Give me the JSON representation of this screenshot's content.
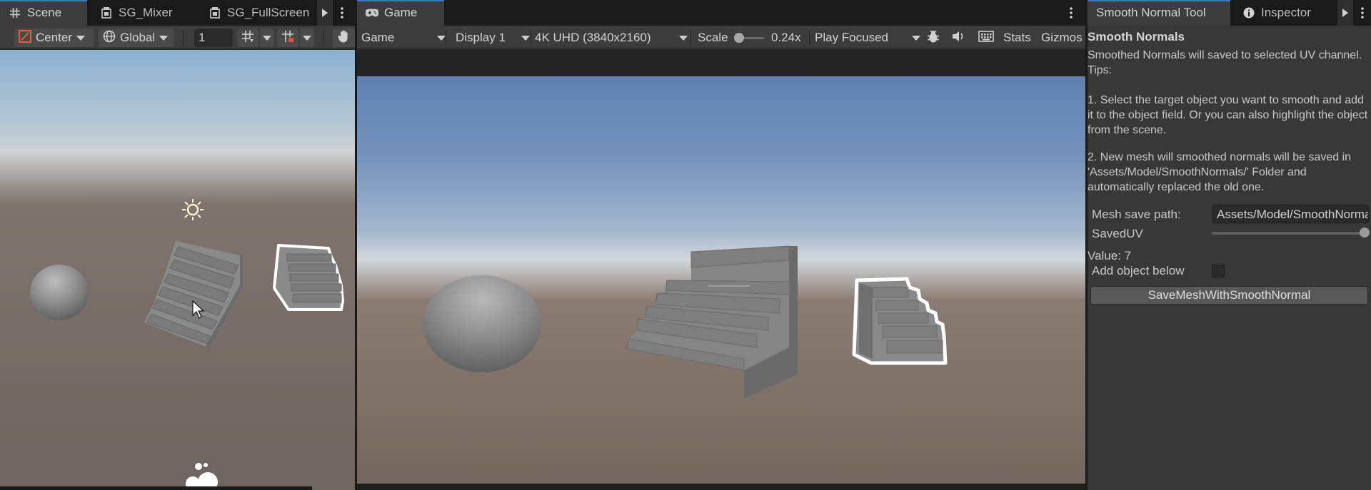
{
  "scene_panel": {
    "tabs": [
      {
        "label": "Scene",
        "icon": "grid-icon"
      },
      {
        "label": "SG_Mixer",
        "icon": "shader-graph-icon"
      },
      {
        "label": "SG_FullScreen",
        "icon": "shader-graph-icon"
      }
    ],
    "toolbar": {
      "pivot_label": "Center",
      "space_label": "Global",
      "grid_value": "1"
    }
  },
  "game_panel": {
    "tab_label": "Game",
    "toolbar": {
      "mode": "Game",
      "display": "Display 1",
      "resolution": "4K UHD (3840x2160)",
      "scale_label": "Scale",
      "scale_value": "0.24x",
      "play_mode": "Play Focused",
      "stats_label": "Stats",
      "gizmos_label": "Gizmos"
    }
  },
  "inspector_panel": {
    "tabs": [
      {
        "label": "Smooth Normal Tool"
      },
      {
        "label": "Inspector",
        "icon": "info-icon"
      }
    ],
    "title": "Smooth Normals",
    "description": "Smoothed Normals will saved to selected UV channel. Tips:",
    "tip1": "1. Select the target object you want to smooth and add it to the object field. Or you can also highlight the object from the scene.",
    "tip2": "2. New mesh will smoothed normals will be saved in 'Assets/Model/SmoothNormals/' Folder and automatically replaced the old one.",
    "mesh_save_path_label": "Mesh save path:",
    "mesh_save_path_value": "Assets/Model/SmoothNormals/",
    "saved_uv_label": "SavedUV",
    "value_text": "Value: 7",
    "add_object_label": "Add object below",
    "save_button_label": "SaveMeshWithSmoothNormal"
  }
}
